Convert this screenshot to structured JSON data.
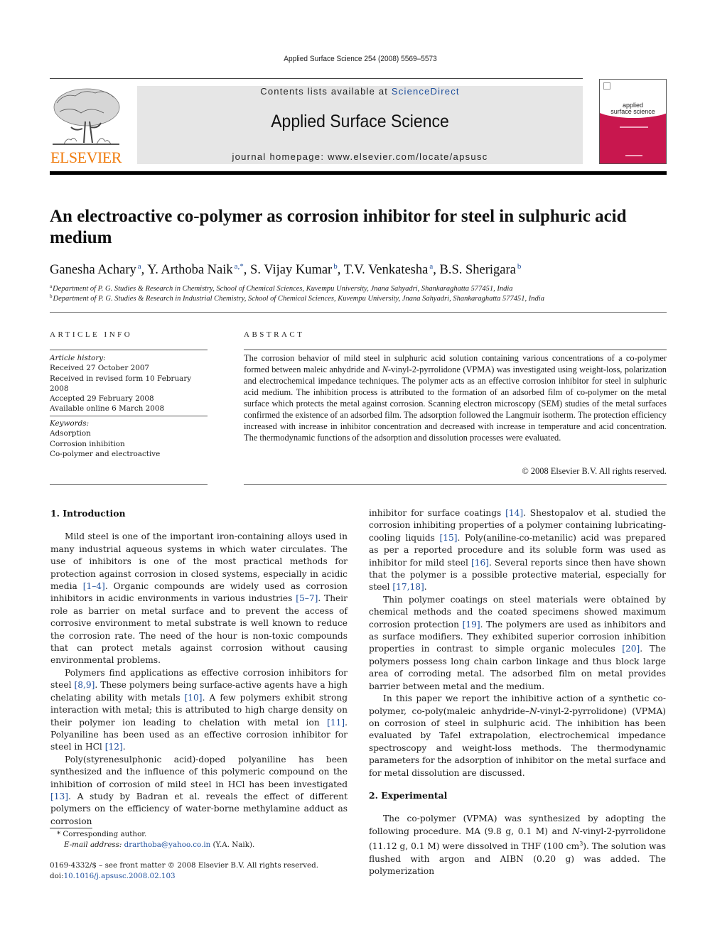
{
  "header": {
    "citation": "Applied Surface Science 254 (2008) 5569–5573",
    "publisher_logo_text": "ELSEVIER",
    "contents_prefix": "Contents lists available at ",
    "contents_link": "ScienceDirect",
    "journal_name": "Applied Surface Science",
    "homepage": "journal homepage: www.elsevier.com/locate/apsusc",
    "cover_title_line1": "applied",
    "cover_title_line2": "surface science"
  },
  "colors": {
    "link": "#1f4f9c",
    "elsevier_orange": "#f07d10",
    "cover_magenta": "#c8174e",
    "banner_gray": "#e6e6e6"
  },
  "article": {
    "title": "An electroactive co-polymer as corrosion inhibitor for steel in sulphuric acid medium",
    "authors": [
      {
        "name": "Ganesha Achary",
        "sup": "a"
      },
      {
        "name": "Y. Arthoba Naik",
        "sup": "a,*"
      },
      {
        "name": "S. Vijay Kumar",
        "sup": "b"
      },
      {
        "name": "T.V. Venkatesha",
        "sup": "a"
      },
      {
        "name": "B.S. Sherigara",
        "sup": "b"
      }
    ],
    "separator": ", ",
    "affiliations": [
      {
        "sup": "a",
        "text": "Department of P. G. Studies & Research in Chemistry, School of Chemical Sciences, Kuvempu University, Jnana Sahyadri, Shankaraghatta 577451, India"
      },
      {
        "sup": "b",
        "text": "Department of P. G. Studies & Research in Industrial Chemistry, School of Chemical Sciences, Kuvempu University, Jnana Sahyadri, Shankaraghatta 577451, India"
      }
    ]
  },
  "article_info": {
    "heading": "ARTICLE INFO",
    "history_label": "Article history:",
    "history": [
      "Received 27 October 2007",
      "Received in revised form 10 February 2008",
      "Accepted 29 February 2008",
      "Available online 6 March 2008"
    ],
    "keywords_label": "Keywords:",
    "keywords": [
      "Adsorption",
      "Corrosion inhibition",
      "Co-polymer and electroactive"
    ]
  },
  "abstract": {
    "heading": "ABSTRACT",
    "text_part1": "The corrosion behavior of mild steel in sulphuric acid solution containing various concentrations of a co-polymer formed between maleic anhydride and ",
    "text_italic": "N",
    "text_part2": "-vinyl-2-pyrrolidone (VPMA) was investigated using weight-loss, polarization and electrochemical impedance techniques. The polymer acts as an effective corrosion inhibitor for steel in sulphuric acid medium. The inhibition process is attributed to the formation of an adsorbed film of co-polymer on the metal surface which protects the metal against corrosion. Scanning electron microscopy (SEM) studies of the metal surfaces confirmed the existence of an adsorbed film. The adsorption followed the Langmuir isotherm. The protection efficiency increased with increase in inhibitor concentration and decreased with increase in temperature and acid concentration. The thermodynamic functions of the adsorption and dissolution processes were evaluated.",
    "copyright": "© 2008 Elsevier B.V. All rights reserved."
  },
  "body": {
    "sec1_heading": "1.  Introduction",
    "p1": [
      {
        "t": "Mild steel is one of the important iron-containing alloys used in many industrial aqueous systems in which water circulates. The use of inhibitors is one of the most practical methods for protection against corrosion in closed systems, especially in acidic media "
      },
      {
        "r": "[1–4]"
      },
      {
        "t": ". Organic compounds are widely used as corrosion inhibitors in acidic environments in various industries "
      },
      {
        "r": "[5–7]"
      },
      {
        "t": ". Their role as barrier on metal surface and to prevent the access of corrosive environment to metal substrate is well known to reduce the corrosion rate. The need of the hour is non-toxic compounds that can protect metals against corrosion without causing environmental problems."
      }
    ],
    "p2": [
      {
        "t": "Polymers find applications as effective corrosion inhibitors for steel "
      },
      {
        "r": "[8,9]"
      },
      {
        "t": ". These polymers being surface-active agents have a high chelating ability with metals "
      },
      {
        "r": "[10]"
      },
      {
        "t": ". A few polymers exhibit strong interaction with metal; this is attributed to high charge density on their polymer ion leading to chelation with metal ion "
      },
      {
        "r": "[11]"
      },
      {
        "t": ". Polyaniline has been used as an effective corrosion inhibitor for steel in HCl "
      },
      {
        "r": "[12]"
      },
      {
        "t": "."
      }
    ],
    "p3": [
      {
        "t": "Poly(styrenesulphonic acid)-doped polyaniline has been synthesized and the influence of this polymeric compound on the inhibition of corrosion of mild steel in HCl has been investigated "
      },
      {
        "r": "[13]"
      },
      {
        "t": ". A study by Badran et al. reveals the effect of different polymers on the efficiency of water-borne methylamine adduct as corrosion inhibitor for surface coatings "
      },
      {
        "r": "[14]"
      },
      {
        "t": ". Shestopalov et al. studied the corrosion inhibiting properties of a polymer containing lubricating-cooling liquids "
      },
      {
        "r": "[15]"
      },
      {
        "t": ". Poly(aniline-co-metanilic) acid was prepared as per a reported procedure and its soluble form was used as inhibitor for mild steel "
      },
      {
        "r": "[16]"
      },
      {
        "t": ". Several reports since then have shown that the polymer is a possible protective material, especially for steel "
      },
      {
        "r": "[17,18]"
      },
      {
        "t": "."
      }
    ],
    "p4": [
      {
        "t": "Thin polymer coatings on steel materials were obtained by chemical methods and the coated specimens showed maximum corrosion protection "
      },
      {
        "r": "[19]"
      },
      {
        "t": ". The polymers are used as inhibitors and as surface modifiers. They exhibited superior corrosion inhibition properties in contrast to simple organic molecules "
      },
      {
        "r": "[20]"
      },
      {
        "t": ". The polymers possess long chain carbon linkage and thus block large area of corroding metal. The adsorbed film on metal provides barrier between metal and the medium."
      }
    ],
    "p5": [
      {
        "t": "In this paper we report the inhibitive action of a synthetic co-polymer, co-poly(maleic anhydride–"
      },
      {
        "i": "N"
      },
      {
        "t": "-vinyl-2-pyrrolidone) (VPMA) on corrosion of steel in sulphuric acid. The inhibition has been evaluated by Tafel extrapolation, electrochemical impedance spectroscopy and weight-loss methods. The thermodynamic parameters for the adsorption of inhibitor on the metal surface and for metal dissolution are discussed."
      }
    ],
    "sec2_heading": "2.  Experimental",
    "p6": [
      {
        "t": "The co-polymer (VPMA) was synthesized by adopting the following procedure. MA (9.8 g, 0.1 M) and "
      },
      {
        "i": "N"
      },
      {
        "t": "-vinyl-2-pyrrolidone (11.12 g, 0.1 M) were dissolved in THF (100 cm"
      },
      {
        "s": "3"
      },
      {
        "t": "). The solution was flushed with argon and AIBN (0.20 g) was added. The polymerization"
      }
    ]
  },
  "footnotes": {
    "corresponding": "*  Corresponding author.",
    "email_label": "E-mail address: ",
    "email": "drarthoba@yahoo.co.in",
    "email_suffix": " (Y.A. Naik).",
    "issn": "0169-4332/$ – see front matter © 2008 Elsevier B.V. All rights reserved.",
    "doi_prefix": "doi:",
    "doi": "10.1016/j.apsusc.2008.02.103"
  }
}
